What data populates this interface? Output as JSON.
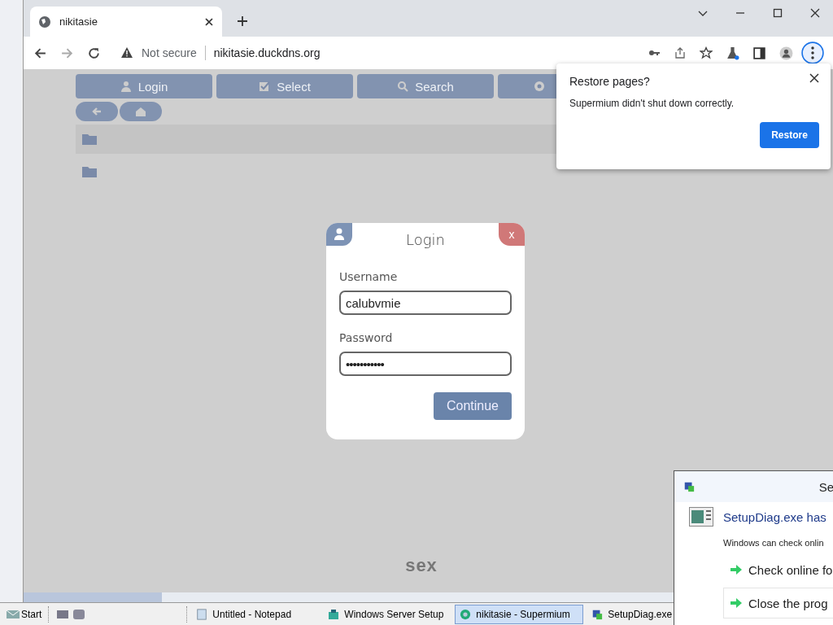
{
  "browser": {
    "tab_title": "nikitasie",
    "security": "Not secure",
    "url": "nikitasie.duckdns.org"
  },
  "page": {
    "nav_buttons": [
      {
        "label": "Login",
        "kind": "user"
      },
      {
        "label": "Select",
        "kind": "check"
      },
      {
        "label": "Search",
        "kind": "search"
      }
    ],
    "footer": "sex"
  },
  "login": {
    "title": "Login",
    "close": "x",
    "username_label": "Username",
    "username": "calubvmie",
    "password_label": "Password",
    "password": "•••••••••••",
    "continue": "Continue"
  },
  "restore": {
    "title": "Restore pages?",
    "message": "Supermium didn't shut down correctly.",
    "button": "Restore"
  },
  "error_dialog": {
    "title": "Se",
    "heading": "SetupDiag.exe has",
    "message": "Windows can check onlin",
    "options": [
      "Check online fo",
      "Close the prog"
    ]
  },
  "taskbar": {
    "start": "Start",
    "tasks": [
      {
        "label": "Untitled - Notepad",
        "kind": "notepad",
        "selected": false
      },
      {
        "label": "Windows Server Setup",
        "kind": "setup",
        "selected": false
      },
      {
        "label": "nikitasie - Supermium",
        "kind": "browser",
        "selected": true
      },
      {
        "label": "SetupDiag.exe",
        "kind": "diag",
        "selected": false
      }
    ]
  }
}
